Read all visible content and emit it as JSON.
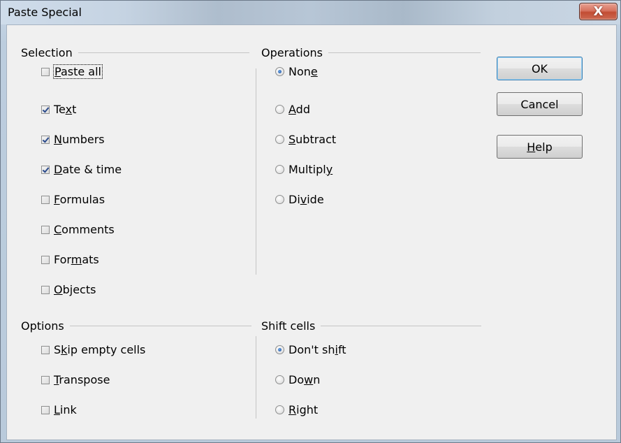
{
  "window": {
    "title": "Paste Special",
    "close_symbol": "X"
  },
  "selection": {
    "title": "Selection",
    "items": [
      {
        "pre": "",
        "key": "P",
        "post": "aste all",
        "checked": false
      },
      {
        "pre": "Te",
        "key": "x",
        "post": "t",
        "checked": true
      },
      {
        "pre": "",
        "key": "N",
        "post": "umbers",
        "checked": true
      },
      {
        "pre": "",
        "key": "D",
        "post": "ate & time",
        "checked": true
      },
      {
        "pre": "",
        "key": "F",
        "post": "ormulas",
        "checked": false
      },
      {
        "pre": "",
        "key": "C",
        "post": "omments",
        "checked": false
      },
      {
        "pre": "For",
        "key": "m",
        "post": "ats",
        "checked": false
      },
      {
        "pre": "",
        "key": "O",
        "post": "bjects",
        "checked": false
      }
    ]
  },
  "operations": {
    "title": "Operations",
    "items": [
      {
        "pre": "Non",
        "key": "e",
        "post": "",
        "selected": true
      },
      {
        "pre": "",
        "key": "A",
        "post": "dd",
        "selected": false
      },
      {
        "pre": "",
        "key": "S",
        "post": "ubtract",
        "selected": false
      },
      {
        "pre": "Multipl",
        "key": "y",
        "post": "",
        "selected": false
      },
      {
        "pre": "Di",
        "key": "v",
        "post": "ide",
        "selected": false
      }
    ]
  },
  "options": {
    "title": "Options",
    "items": [
      {
        "pre": "S",
        "key": "k",
        "post": "ip empty cells",
        "checked": false
      },
      {
        "pre": "",
        "key": "T",
        "post": "ranspose",
        "checked": false
      },
      {
        "pre": "",
        "key": "L",
        "post": "ink",
        "checked": false
      }
    ]
  },
  "shift_cells": {
    "title": "Shift cells",
    "items": [
      {
        "pre": "Don't sh",
        "key": "i",
        "post": "ft",
        "selected": true
      },
      {
        "pre": "Do",
        "key": "w",
        "post": "n",
        "selected": false
      },
      {
        "pre": "",
        "key": "R",
        "post": "ight",
        "selected": false
      }
    ]
  },
  "buttons": {
    "ok": {
      "pre": "OK",
      "key": "",
      "post": ""
    },
    "cancel": {
      "pre": "Cancel",
      "key": "",
      "post": ""
    },
    "help": {
      "pre": "",
      "key": "H",
      "post": "elp"
    }
  }
}
